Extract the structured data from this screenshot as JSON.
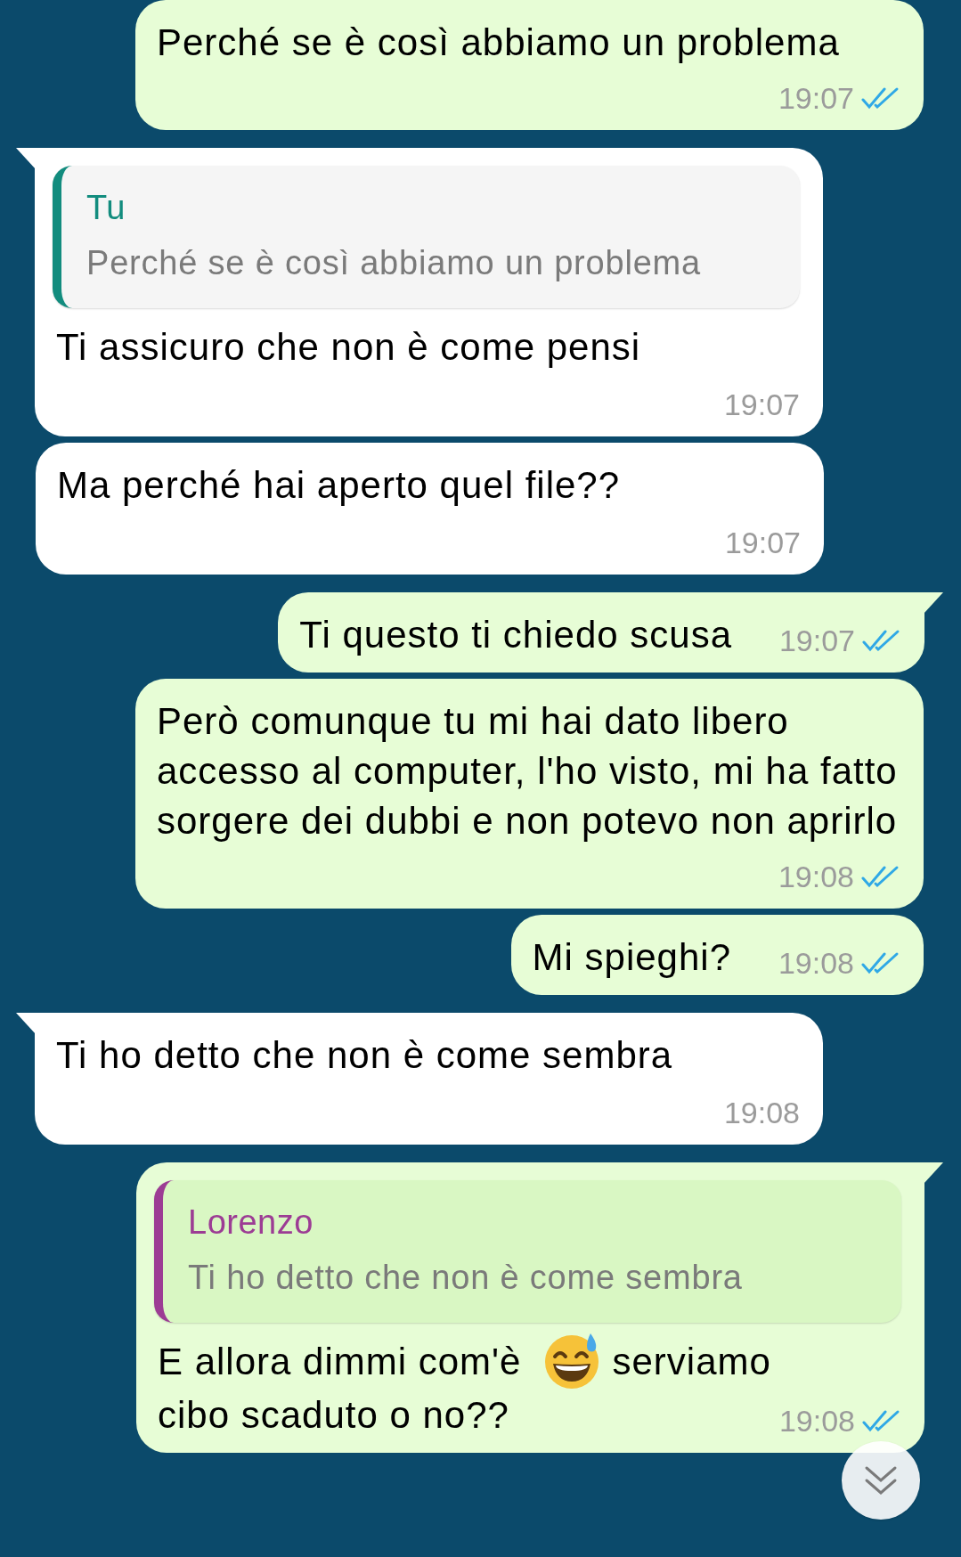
{
  "messages": [
    {
      "outgoing": true,
      "tail": false,
      "text": "Perché se è così abbiamo un problema",
      "time": "19:07",
      "read": true
    },
    {
      "outgoing": false,
      "tail": true,
      "quote": {
        "author": "Tu",
        "text": "Perché se è così abbiamo un problema",
        "color": "#128c7e"
      },
      "text": "Ti assicuro che non è come pensi",
      "time": "19:07"
    },
    {
      "outgoing": false,
      "tail": false,
      "text": "Ma perché hai aperto quel file??",
      "time": "19:07"
    },
    {
      "outgoing": true,
      "tail": true,
      "text": "Ti questo ti chiedo scusa",
      "time": "19:07",
      "read": true
    },
    {
      "outgoing": true,
      "tail": false,
      "text": "Però comunque tu mi hai dato libero accesso al computer, l'ho visto, mi ha fatto sorgere dei dubbi e non potevo non aprirlo",
      "time": "19:08",
      "read": true
    },
    {
      "outgoing": true,
      "tail": false,
      "text": "Mi spieghi?",
      "time": "19:08",
      "read": true
    },
    {
      "outgoing": false,
      "tail": true,
      "text": "Ti ho detto che non è come sembra",
      "time": "19:08"
    },
    {
      "outgoing": true,
      "tail": true,
      "quote": {
        "author": "Lorenzo",
        "text": "Ti ho detto che non è come sembra",
        "color": "#9c3c94"
      },
      "parts": [
        {
          "kind": "text",
          "text": "E allora dimmi com'è"
        },
        {
          "kind": "emoji"
        },
        {
          "kind": "text",
          "text": "serviamo"
        },
        {
          "kind": "text",
          "text": "cibo scaduto o no??"
        }
      ],
      "time": "19:08",
      "read": true
    }
  ]
}
